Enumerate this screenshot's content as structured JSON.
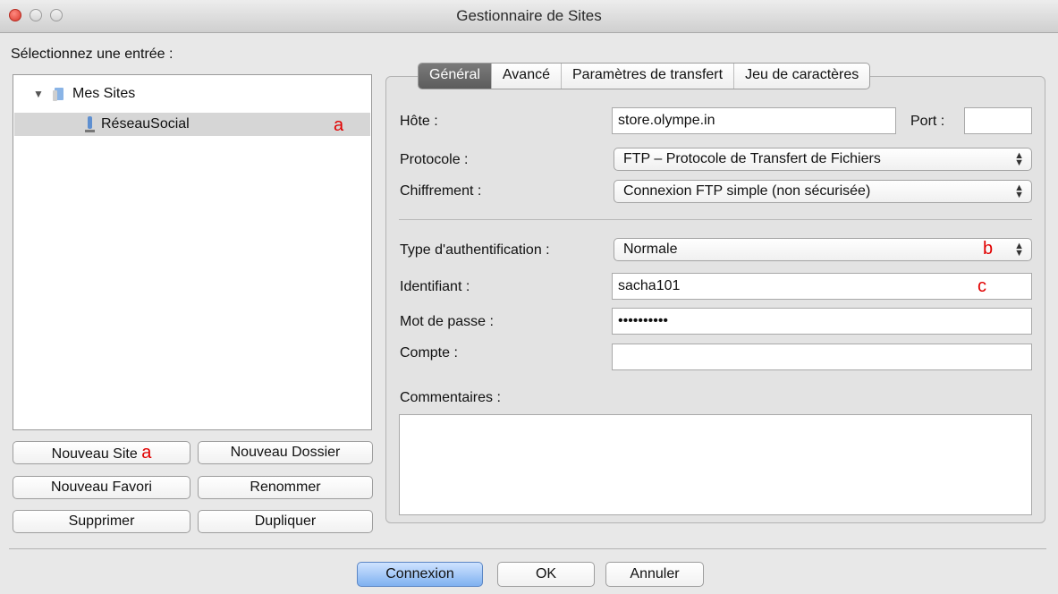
{
  "window": {
    "title": "Gestionnaire de Sites"
  },
  "left": {
    "select_label": "Sélectionnez une entrée :",
    "tree": {
      "root_label": "Mes Sites",
      "site_label": "RéseauSocial",
      "site_marker": "a"
    },
    "buttons": {
      "new_site": "Nouveau Site",
      "new_site_marker": "a",
      "new_folder": "Nouveau Dossier",
      "new_bookmark": "Nouveau Favori",
      "rename": "Renommer",
      "delete": "Supprimer",
      "duplicate": "Dupliquer"
    }
  },
  "tabs": [
    "Général",
    "Avancé",
    "Paramètres de transfert",
    "Jeu de caractères"
  ],
  "form": {
    "host_label": "Hôte :",
    "host_value": "store.olympe.in",
    "port_label": "Port :",
    "port_value": "",
    "protocol_label": "Protocole :",
    "protocol_value": "FTP – Protocole de Transfert de Fichiers",
    "encryption_label": "Chiffrement :",
    "encryption_value": "Connexion FTP simple (non sécurisée)",
    "auth_label": "Type d'authentification :",
    "auth_value": "Normale",
    "auth_marker": "b",
    "user_label": "Identifiant :",
    "user_value": "sacha101",
    "user_marker": "c",
    "password_label": "Mot de passe :",
    "password_value": "••••••••••",
    "account_label": "Compte :",
    "account_value": "",
    "comments_label": "Commentaires :",
    "comments_value": ""
  },
  "footer": {
    "connect": "Connexion",
    "ok": "OK",
    "cancel": "Annuler"
  },
  "colors": {
    "marker": "#e10000",
    "tab_active": "#666666",
    "default_button": "#8cbaf2"
  }
}
